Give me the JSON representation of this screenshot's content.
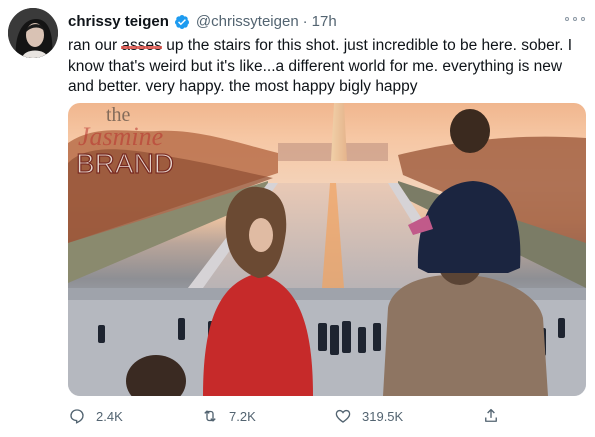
{
  "tweet": {
    "display_name": "chrissy teigen",
    "handle": "@chrissyteigen",
    "separator": "·",
    "time": "17h",
    "text_before": "ran our ",
    "text_struck": "asses",
    "text_after": " up the stairs for this shot. just incredible to be here. sober. I know that's weird but it's like...a different world for me. everything is new and better. very happy. the most happy bigly happy",
    "watermark": {
      "line1": "the",
      "line2": "Jasmine",
      "line3": "BRAND"
    },
    "actions": {
      "replies": "2.4K",
      "retweets": "7.2K",
      "likes": "319.5K"
    }
  },
  "icons": {
    "verified": "verified-badge-icon",
    "more": "more-options-icon",
    "reply": "reply-icon",
    "retweet": "retweet-icon",
    "like": "heart-icon",
    "share": "share-icon"
  },
  "colors": {
    "verified": "#1d9bf0",
    "text": "#0f1419",
    "secondary": "#536471",
    "watermark_red": "#b8322e"
  }
}
